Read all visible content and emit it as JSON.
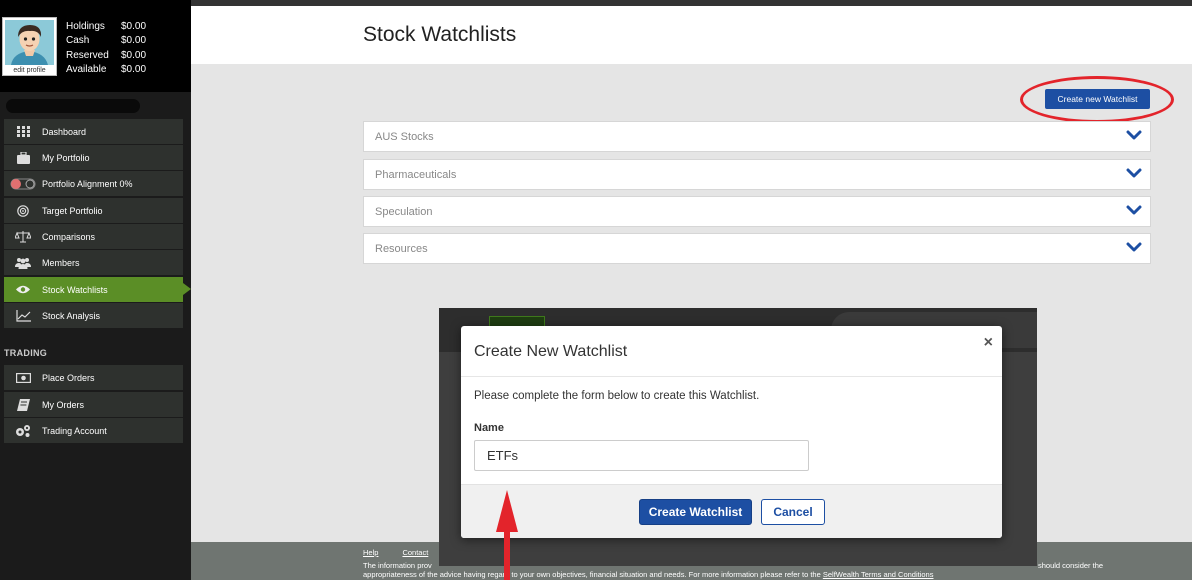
{
  "profile": {
    "edit_label": "edit profile",
    "balances": [
      {
        "label": "Holdings",
        "value": "$0.00"
      },
      {
        "label": "Cash",
        "value": "$0.00"
      },
      {
        "label": "Reserved",
        "value": "$0.00"
      },
      {
        "label": "Available",
        "value": "$0.00"
      }
    ]
  },
  "sidebar": {
    "items": [
      {
        "label": "Dashboard",
        "icon": "grid-icon"
      },
      {
        "label": "My Portfolio",
        "icon": "briefcase-icon"
      },
      {
        "label": "Portfolio Alignment 0%",
        "icon": "toggle-icon"
      },
      {
        "label": "Target Portfolio",
        "icon": "target-icon"
      },
      {
        "label": "Comparisons",
        "icon": "scales-icon"
      },
      {
        "label": "Members",
        "icon": "members-icon"
      },
      {
        "label": "Stock Watchlists",
        "icon": "eye-icon",
        "active": true
      },
      {
        "label": "Stock Analysis",
        "icon": "line-chart-icon"
      }
    ],
    "trading_heading": "TRADING",
    "trading_items": [
      {
        "label": "Place Orders",
        "icon": "money-icon"
      },
      {
        "label": "My Orders",
        "icon": "book-icon"
      },
      {
        "label": "Trading Account",
        "icon": "gears-icon"
      }
    ],
    "active_color": "#5b8e26"
  },
  "main": {
    "title": "Stock Watchlists",
    "create_button": "Create new Watchlist",
    "watchlists": [
      "AUS Stocks",
      "Pharmaceuticals",
      "Speculation",
      "Resources"
    ],
    "accent_color": "#1d4fa3",
    "highlight_color": "#e3242b"
  },
  "footer": {
    "links": [
      "Help",
      "Contact"
    ],
    "disclaimer_start": "The information prov",
    "disclaimer_tail": "should consider the",
    "disclaimer_line2": "appropriateness of the advice having regard to your own objectives, financial situation and needs. For more information please refer to the ",
    "terms_link": "SelfWealth Terms and Conditions"
  },
  "modal": {
    "title": "Create New Watchlist",
    "close": "×",
    "description": "Please complete the form below to create this Watchlist.",
    "name_label": "Name",
    "name_value": "ETFs",
    "create_button": "Create Watchlist",
    "cancel_button": "Cancel"
  }
}
